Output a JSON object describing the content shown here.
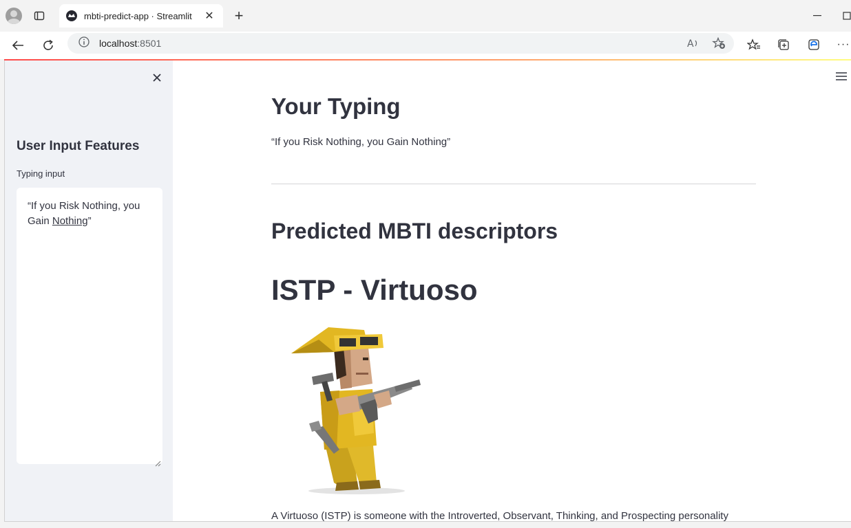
{
  "browser": {
    "tab_title": "mbti-predict-app · Streamlit",
    "url_host": "localhost",
    "url_port": ":8501"
  },
  "sidebar": {
    "title": "User Input Features",
    "input_label": "Typing input",
    "input_value_line1": "“If you Risk Nothing, you",
    "input_value_line2_a": "Gain ",
    "input_value_line2_b": "Nothing",
    "input_value_line2_c": "”"
  },
  "main": {
    "title": "Your Typing",
    "quote": "“If you Risk Nothing, you Gain Nothing”",
    "section_title": "Predicted MBTI descriptors",
    "type_heading": "ISTP - Virtuoso",
    "description": "A Virtuoso (ISTP) is someone with the Introverted, Observant, Thinking, and Prospecting personality"
  },
  "colors": {
    "accent": "#ff4b4b",
    "text": "#31333f",
    "sidebar_bg": "#f0f2f6"
  }
}
